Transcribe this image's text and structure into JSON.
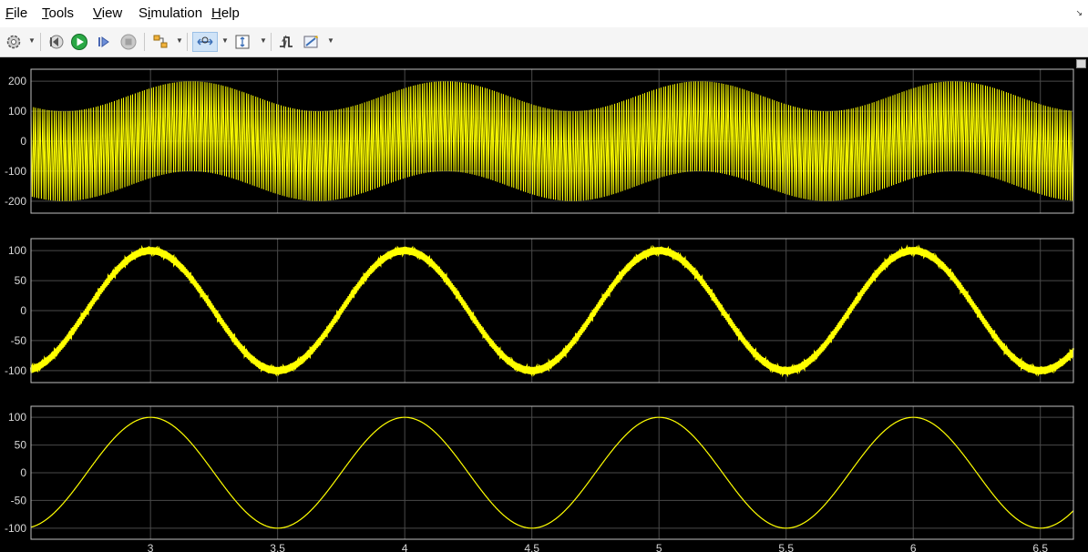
{
  "menu": {
    "items": [
      {
        "label": "File",
        "key": "F",
        "rest": "ile"
      },
      {
        "label": "Tools",
        "key": "T",
        "rest": "ools"
      },
      {
        "label": "View",
        "key": "V",
        "rest": "iew"
      },
      {
        "label": "Simulation",
        "pre": "S",
        "key": "i",
        "rest": "mulation"
      },
      {
        "label": "Help",
        "key": "H",
        "rest": "elp"
      }
    ]
  },
  "toolbar": {
    "buttons": [
      {
        "name": "settings-gear-icon"
      },
      {
        "name": "step-back-icon"
      },
      {
        "name": "run-icon"
      },
      {
        "name": "step-forward-icon"
      },
      {
        "name": "stop-icon"
      },
      {
        "name": "highlight-model-icon"
      },
      {
        "name": "zoom-x-icon"
      },
      {
        "name": "autoscale-icon"
      },
      {
        "name": "triggers-icon"
      },
      {
        "name": "cursor-measurements-icon"
      }
    ]
  },
  "colors": {
    "trace": "#ffff00",
    "plot_bg": "#000000",
    "grid": "#4a4a4a",
    "axes_border": "#bfbfbf",
    "tick_text": "#d9d9d9"
  },
  "chart_data": [
    {
      "type": "line",
      "ylim": [
        -240,
        240
      ],
      "yticks": [
        200,
        100,
        0,
        -100,
        -200
      ],
      "yticklabels": [
        "200",
        "100",
        "0",
        "-100",
        "-200"
      ],
      "xticks": [
        1,
        1.5,
        2,
        2.5,
        3,
        3.5,
        4,
        4.5
      ],
      "xlim": [
        0.53,
        4.63
      ],
      "series": [
        {
          "style": "amplitude modulated carrier",
          "envelope_center_amplitude": 100,
          "envelope_offset": [
            0,
            100
          ],
          "carrier_amplitude": 100,
          "low_frequency_period": 1.0,
          "phase_peak_at": 1.16
        }
      ]
    },
    {
      "type": "line",
      "ylim": [
        -120,
        120
      ],
      "yticks": [
        100,
        50,
        0,
        -50,
        -100
      ],
      "yticklabels": [
        "100",
        "50",
        "0",
        "-50",
        "-100"
      ],
      "xticks": [
        1,
        1.5,
        2,
        2.5,
        3,
        3.5,
        4,
        4.5
      ],
      "xlim": [
        0.53,
        4.63
      ],
      "series": [
        {
          "style": "sine with small ripple",
          "amplitude": 100,
          "ripple": 6,
          "period": 1.0,
          "phase_peak_at": 1.0
        }
      ]
    },
    {
      "type": "line",
      "ylim": [
        -120,
        120
      ],
      "yticks": [
        100,
        50,
        0,
        -50,
        -100
      ],
      "yticklabels": [
        "100",
        "50",
        "0",
        "-50",
        "-100"
      ],
      "xticks": [
        1,
        1.5,
        2,
        2.5,
        3,
        3.5,
        4,
        4.5
      ],
      "xticklabels": [
        "3",
        "3.5",
        "4",
        "4.5",
        "5",
        "5.5",
        "6",
        "6.5"
      ],
      "xlim": [
        0.53,
        4.63
      ],
      "series": [
        {
          "style": "pure sine",
          "amplitude": 100,
          "period": 1.0,
          "phase_peak_at": 1.0
        }
      ]
    }
  ]
}
